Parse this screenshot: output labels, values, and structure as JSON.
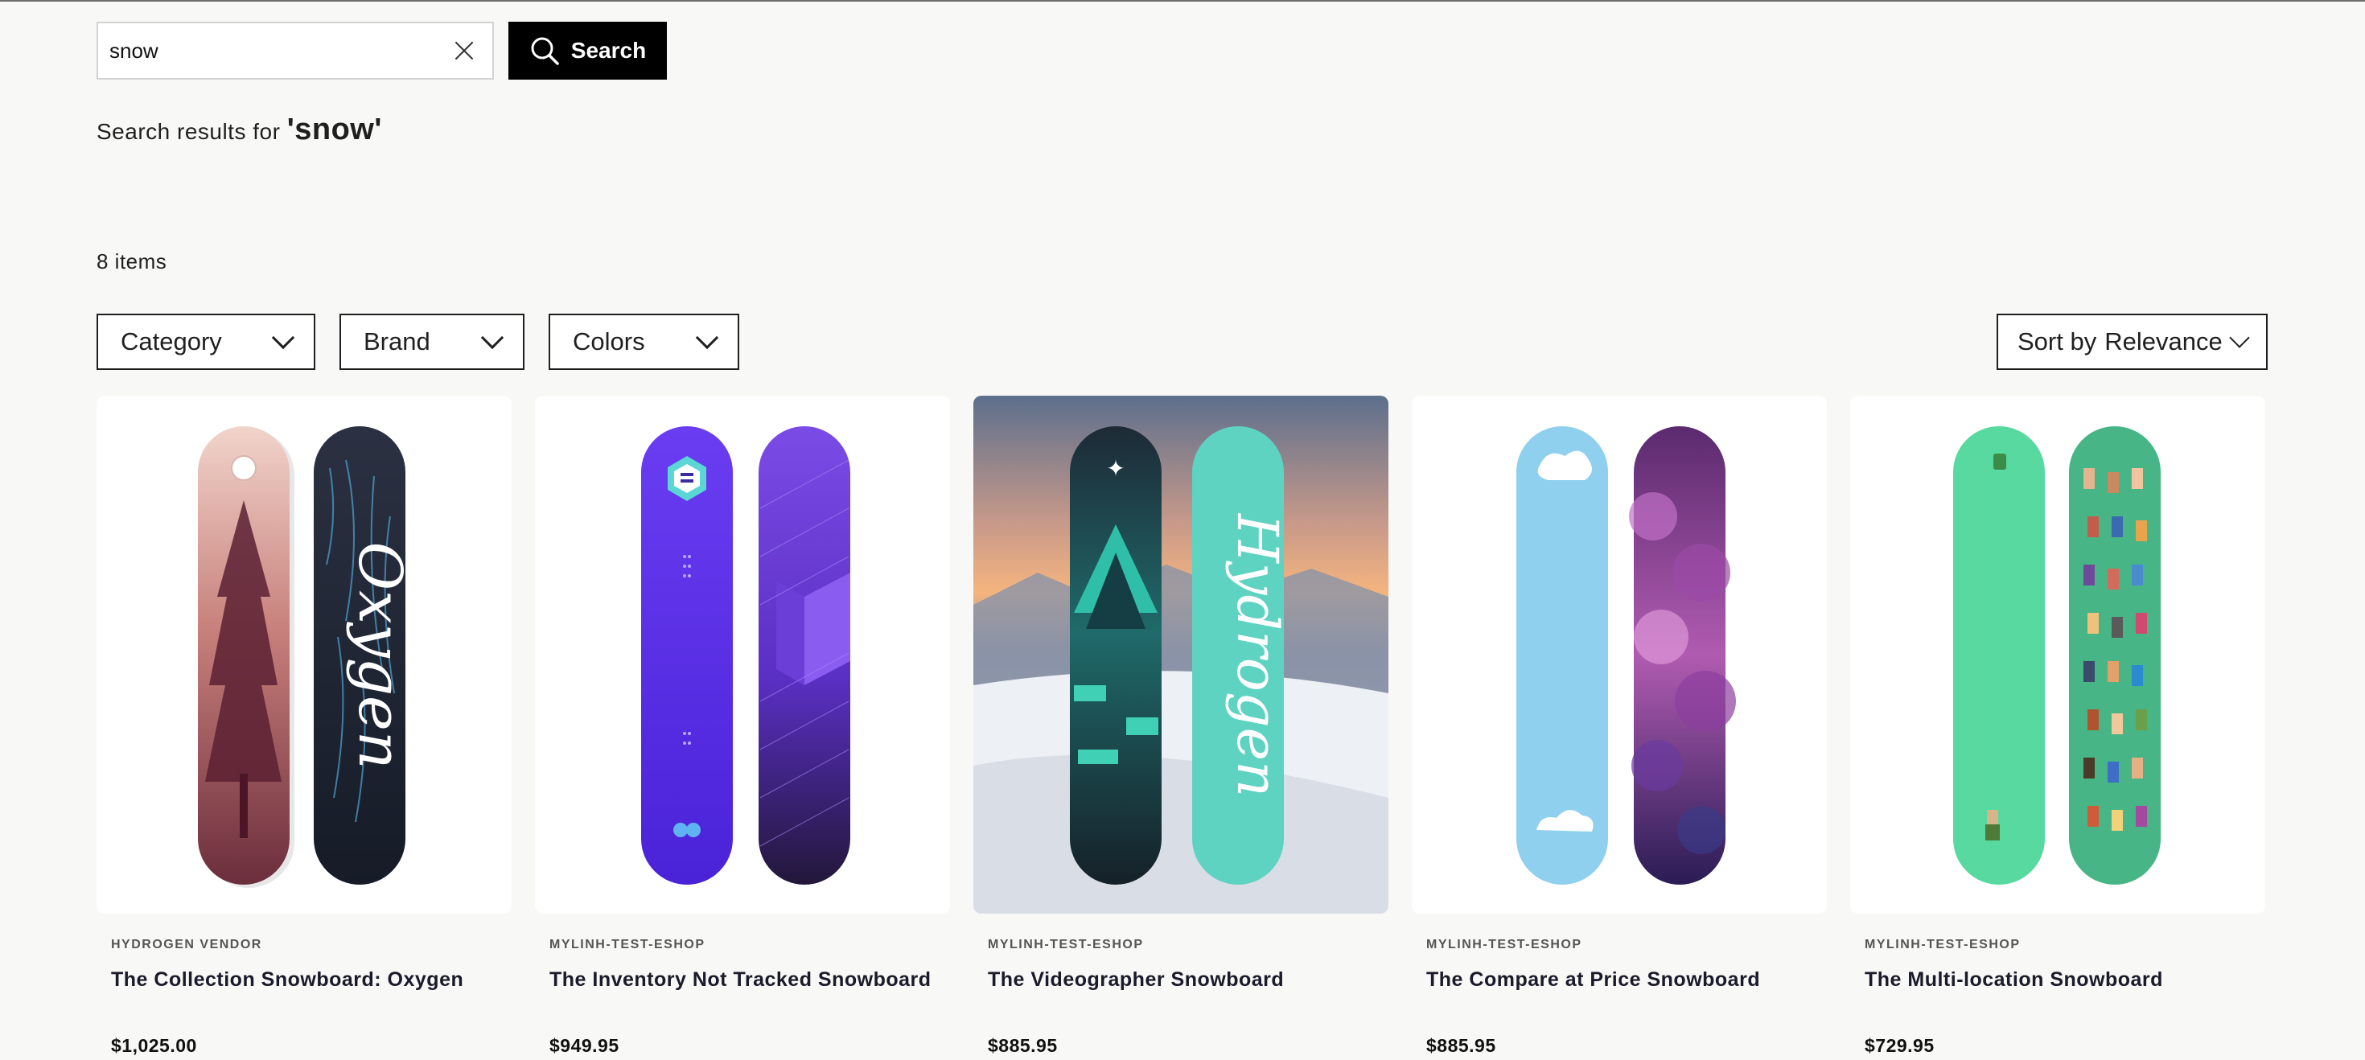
{
  "search": {
    "value": "snow",
    "placeholder": "Search",
    "button_label": "Search"
  },
  "results": {
    "prefix": "Search results for",
    "query": "'snow'",
    "count_label": "8 items"
  },
  "filters": [
    {
      "label": "Category"
    },
    {
      "label": "Brand"
    },
    {
      "label": "Colors"
    }
  ],
  "sort": {
    "prefix": "Sort by",
    "value": "Relevance"
  },
  "products": [
    {
      "vendor": "HYDROGEN VENDOR",
      "title": "The Collection Snowboard: Oxygen",
      "price": "$1,025.00",
      "board_text": "Oxygen"
    },
    {
      "vendor": "MYLINH-TEST-ESHOP",
      "title": "The Inventory Not Tracked Snowboard",
      "price": "$949.95"
    },
    {
      "vendor": "MYLINH-TEST-ESHOP",
      "title": "The Videographer Snowboard",
      "price": "$885.95",
      "board_text": "Hydrogen"
    },
    {
      "vendor": "MYLINH-TEST-ESHOP",
      "title": "The Compare at Price Snowboard",
      "price": "$885.95"
    },
    {
      "vendor": "MYLINH-TEST-ESHOP",
      "title": "The Multi-location Snowboard",
      "price": "$729.95"
    }
  ],
  "colors": {
    "background": "#f8f8f6",
    "accent": "#000000",
    "card": "#ffffff"
  }
}
